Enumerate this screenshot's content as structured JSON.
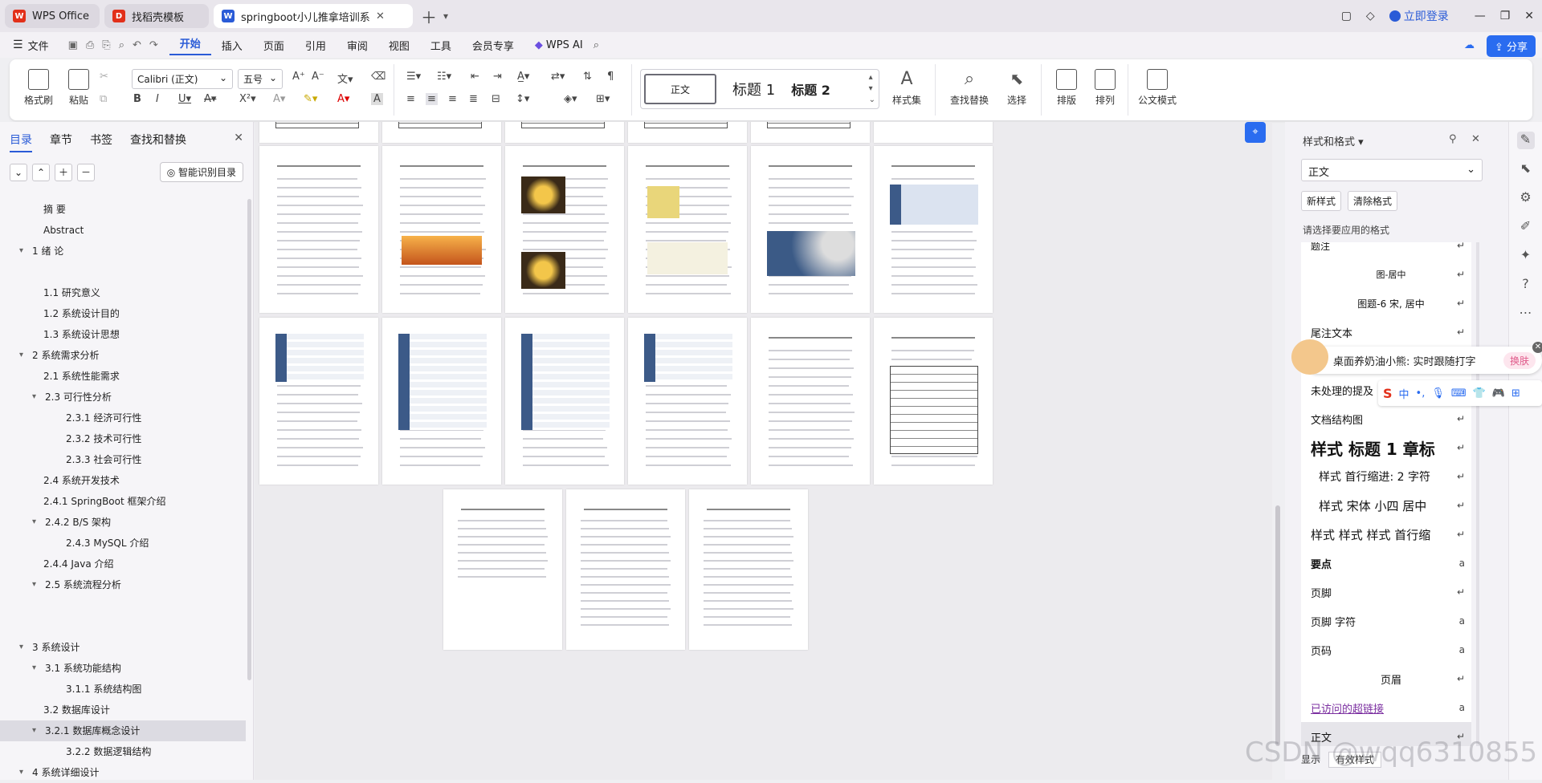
{
  "tabs": [
    {
      "label": "WPS Office",
      "icon": "wps-logo-icon",
      "color": "#e2301a"
    },
    {
      "label": "找稻壳模板",
      "icon": "docer-icon",
      "color": "#e2301a"
    },
    {
      "label": "springboot小儿推拿培训系统",
      "icon": "writer-doc-icon",
      "color": "#2a5bd7"
    }
  ],
  "window": {
    "login": "立即登录"
  },
  "menu": {
    "file": "文件",
    "items": [
      "开始",
      "插入",
      "页面",
      "引用",
      "审阅",
      "视图",
      "工具",
      "会员专享"
    ],
    "active": "开始",
    "ai": "WPS AI",
    "share": "分享"
  },
  "ribbon": {
    "format_painter": "格式刷",
    "paste": "粘贴",
    "font_name": "Calibri (正文)",
    "font_size": "五号",
    "styles": [
      "正文",
      "标题 1",
      "标题 2"
    ],
    "style_set": "样式集",
    "find_replace": "查找替换",
    "select": "选择",
    "layout": "排版",
    "arrange": "排列",
    "doc_mode": "公文模式"
  },
  "left_panel": {
    "tabs": [
      "目录",
      "章节",
      "书签",
      "查找和替换"
    ],
    "active_tab": "目录",
    "smart_btn": "智能识别目录",
    "toc": [
      {
        "text": "摘 要",
        "indent": 1
      },
      {
        "text": "Abstract",
        "indent": 1
      },
      {
        "text": "1 绪 论",
        "indent": 0,
        "expand": true
      },
      {
        "text": "",
        "indent": 0
      },
      {
        "text": "1.1 研究意义",
        "indent": 1
      },
      {
        "text": "1.2 系统设计目的",
        "indent": 1
      },
      {
        "text": "1.3 系统设计思想",
        "indent": 1
      },
      {
        "text": "2 系统需求分析",
        "indent": 0,
        "expand": true
      },
      {
        "text": "2.1 系统性能需求",
        "indent": 1
      },
      {
        "text": "2.3 可行性分析",
        "indent": 1,
        "expand": true
      },
      {
        "text": "2.3.1 经济可行性",
        "indent": 2
      },
      {
        "text": "2.3.2 技术可行性",
        "indent": 2
      },
      {
        "text": "2.3.3 社会可行性",
        "indent": 2
      },
      {
        "text": "2.4 系统开发技术",
        "indent": 1
      },
      {
        "text": "2.4.1 SpringBoot 框架介绍",
        "indent": 1
      },
      {
        "text": "2.4.2 B/S 架构",
        "indent": 1,
        "expand": true
      },
      {
        "text": "2.4.3 MySQL 介绍",
        "indent": 2
      },
      {
        "text": "2.4.4 Java 介绍",
        "indent": 1
      },
      {
        "text": "2.5 系统流程分析",
        "indent": 1,
        "expand": true
      },
      {
        "text": "",
        "indent": 0
      },
      {
        "text": "",
        "indent": 0
      },
      {
        "text": "3 系统设计",
        "indent": 0,
        "expand": true
      },
      {
        "text": "3.1 系统功能结构",
        "indent": 1,
        "expand": true
      },
      {
        "text": "3.1.1 系统结构图",
        "indent": 2
      },
      {
        "text": "3.2 数据库设计",
        "indent": 1
      },
      {
        "text": "3.2.1 数据库概念设计",
        "indent": 1,
        "expand": true,
        "selected": true
      },
      {
        "text": "3.2.2 数据逻辑结构",
        "indent": 2
      },
      {
        "text": "4 系统详细设计",
        "indent": 0,
        "expand": true
      }
    ]
  },
  "right_panel": {
    "title": "样式和格式",
    "current": "正文",
    "new_style": "新样式",
    "clear_format": "清除格式",
    "hint": "请选择要应用的格式",
    "styles": [
      {
        "text": "题注",
        "size": 12,
        "align": "left",
        "arrow": "↵"
      },
      {
        "text": "图-居中",
        "size": 11,
        "align": "center",
        "arrow": "↵"
      },
      {
        "text": "图题-6 宋, 居中",
        "size": 12,
        "align": "center",
        "arrow": "↵"
      },
      {
        "text": "尾注文本",
        "size": 13,
        "align": "left",
        "arrow": "↵"
      },
      {
        "text": "",
        "size": 13,
        "align": "left",
        "arrow": ""
      },
      {
        "text": "未处理的提及",
        "size": 13,
        "align": "left",
        "arrow": ""
      },
      {
        "text": "文档结构图",
        "size": 13,
        "align": "left",
        "arrow": "↵"
      },
      {
        "text": "样式 标题 1 章标",
        "size": 20,
        "align": "left",
        "arrow": "↵",
        "bold": true
      },
      {
        "text": "样式 首行缩进: 2 字符",
        "size": 14,
        "align": "left",
        "arrow": "↵",
        "indent": true
      },
      {
        "text": "样式 宋体 小四 居中",
        "size": 15,
        "align": "left",
        "arrow": "↵",
        "indent": true
      },
      {
        "text": "样式 样式 样式 首行缩",
        "size": 15,
        "align": "left",
        "arrow": "↵"
      },
      {
        "text": "要点",
        "size": 13,
        "align": "left",
        "arrow": "a",
        "bold": true
      },
      {
        "text": "页脚",
        "size": 13,
        "align": "left",
        "arrow": "↵"
      },
      {
        "text": "页脚 字符",
        "size": 13,
        "align": "left",
        "arrow": "a"
      },
      {
        "text": "页码",
        "size": 13,
        "align": "left",
        "arrow": "a"
      },
      {
        "text": "页眉",
        "size": 13,
        "align": "center",
        "arrow": "↵"
      },
      {
        "text": "已访问的超链接",
        "size": 13,
        "align": "left",
        "arrow": "a",
        "link": true
      },
      {
        "text": "正文",
        "size": 13,
        "align": "left",
        "arrow": "↵",
        "selected": true
      }
    ],
    "display_label": "显示",
    "display_value": "有效样式"
  },
  "popup": {
    "text": "桌面养奶油小熊: 实时跟随打字",
    "action": "换肤"
  },
  "ime": {
    "mode": "中"
  },
  "watermark": "CSDN @wqq6310855"
}
